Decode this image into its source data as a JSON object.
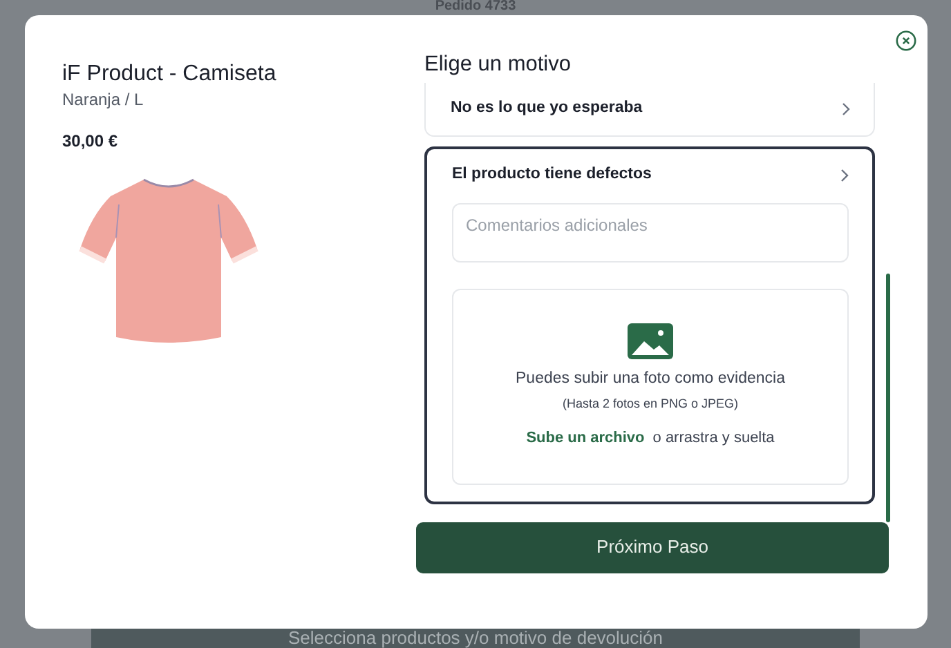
{
  "background_page": {
    "title": "Pedido 4733",
    "footer_bar": "Selecciona productos y/o motivo de devolución"
  },
  "product": {
    "name": "iF Product - Camiseta",
    "variant": "Naranja / L",
    "price": "30,00 €"
  },
  "reasons_heading": "Elige un motivo",
  "reasons": [
    {
      "label": "No es lo que yo esperaba",
      "selected": false
    },
    {
      "label": "El producto tiene defectos",
      "selected": true,
      "comments": {
        "placeholder": "Comentarios adicionales"
      },
      "upload": {
        "text": "Puedes subir una foto como evidencia",
        "hint": "(Hasta 2 fotos en PNG o JPEG)",
        "link": "Sube un archivo",
        "suffix": "o arrastra y suelta"
      }
    }
  ],
  "next_button": "Próximo Paso"
}
